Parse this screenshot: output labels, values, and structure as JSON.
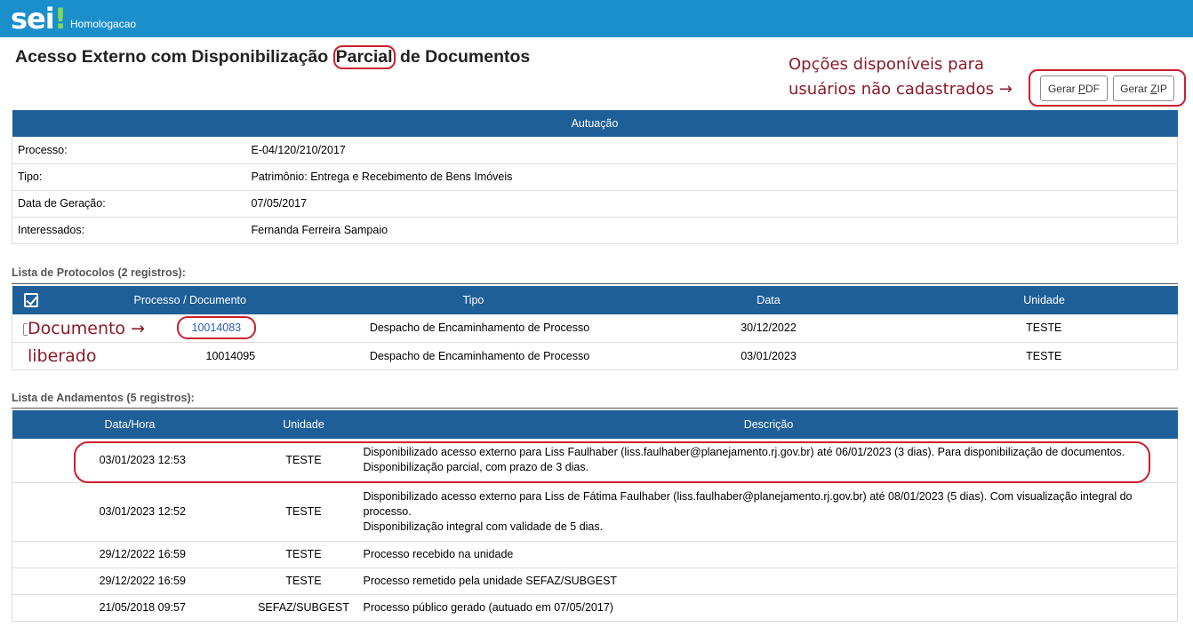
{
  "header": {
    "logo_text": "sei",
    "logo_mark": "!",
    "environment": "Homologacao"
  },
  "page_title": {
    "before": "Acesso Externo com Disponibilização ",
    "highlight": "Parcial",
    "after": " de Documentos"
  },
  "annotations": {
    "options_line1": "Opções disponíveis para",
    "options_line2": "usuários não cadastrados →",
    "doc_line1": "Documento →",
    "doc_line2": "liberado"
  },
  "buttons": {
    "pdf": {
      "prefix": "Gerar ",
      "key": "P",
      "rest": "DF"
    },
    "zip": {
      "prefix": "Gerar ",
      "key": "Z",
      "rest": "IP"
    }
  },
  "autuacao": {
    "title": "Autuação",
    "rows": [
      {
        "label": "Processo:",
        "value": "E-04/120/210/2017"
      },
      {
        "label": "Tipo:",
        "value": "Patrimônio: Entrega e Recebimento de Bens Imóveis"
      },
      {
        "label": "Data de Geração:",
        "value": "07/05/2017"
      },
      {
        "label": "Interessados:",
        "value": "Fernanda Ferreira Sampaio"
      }
    ]
  },
  "protocolos": {
    "caption": "Lista de Protocolos (2 registros):",
    "headers": [
      "Processo / Documento",
      "Tipo",
      "Data",
      "Unidade"
    ],
    "rows": [
      {
        "doc": "10014083",
        "tipo": "Despacho de Encaminhamento de Processo",
        "data": "30/12/2022",
        "unidade": "TESTE"
      },
      {
        "doc": "10014095",
        "tipo": "Despacho de Encaminhamento de Processo",
        "data": "03/01/2023",
        "unidade": "TESTE"
      }
    ]
  },
  "andamentos": {
    "caption": "Lista de Andamentos (5 registros):",
    "headers": [
      "Data/Hora",
      "Unidade",
      "Descrição"
    ],
    "rows": [
      {
        "datahora": "03/01/2023 12:53",
        "unidade": "TESTE",
        "desc1": "Disponibilizado acesso externo para Liss Faulhaber (liss.faulhaber@planejamento.rj.gov.br) até 06/01/2023 (3 dias). Para disponibilização de documentos.",
        "desc2": "Disponibilização parcial, com prazo de 3 dias.",
        "desc3": ""
      },
      {
        "datahora": "03/01/2023 12:52",
        "unidade": "TESTE",
        "desc1": "Disponibilizado acesso externo para Liss de Fátima Faulhaber (liss.faulhaber@planejamento.rj.gov.br) até 08/01/2023 (5 dias). Com visualização integral do",
        "desc2": "processo.",
        "desc3": "Disponibilização integral com validade de 5 dias."
      },
      {
        "datahora": "29/12/2022 16:59",
        "unidade": "TESTE",
        "desc1": "Processo recebido na unidade",
        "desc2": "",
        "desc3": ""
      },
      {
        "datahora": "29/12/2022 16:59",
        "unidade": "TESTE",
        "desc1": "Processo remetido pela unidade SEFAZ/SUBGEST",
        "desc2": "",
        "desc3": ""
      },
      {
        "datahora": "21/05/2018 09:57",
        "unidade": "SEFAZ/SUBGEST",
        "desc1": "Processo público gerado (autuado em 07/05/2017)",
        "desc2": "",
        "desc3": ""
      }
    ]
  },
  "colors": {
    "topbar": "#1b8fcc",
    "table_header": "#1e5f99",
    "highlight": "#cc1f2e",
    "annotation_text": "#8b1a2a",
    "link": "#2a5db0"
  }
}
